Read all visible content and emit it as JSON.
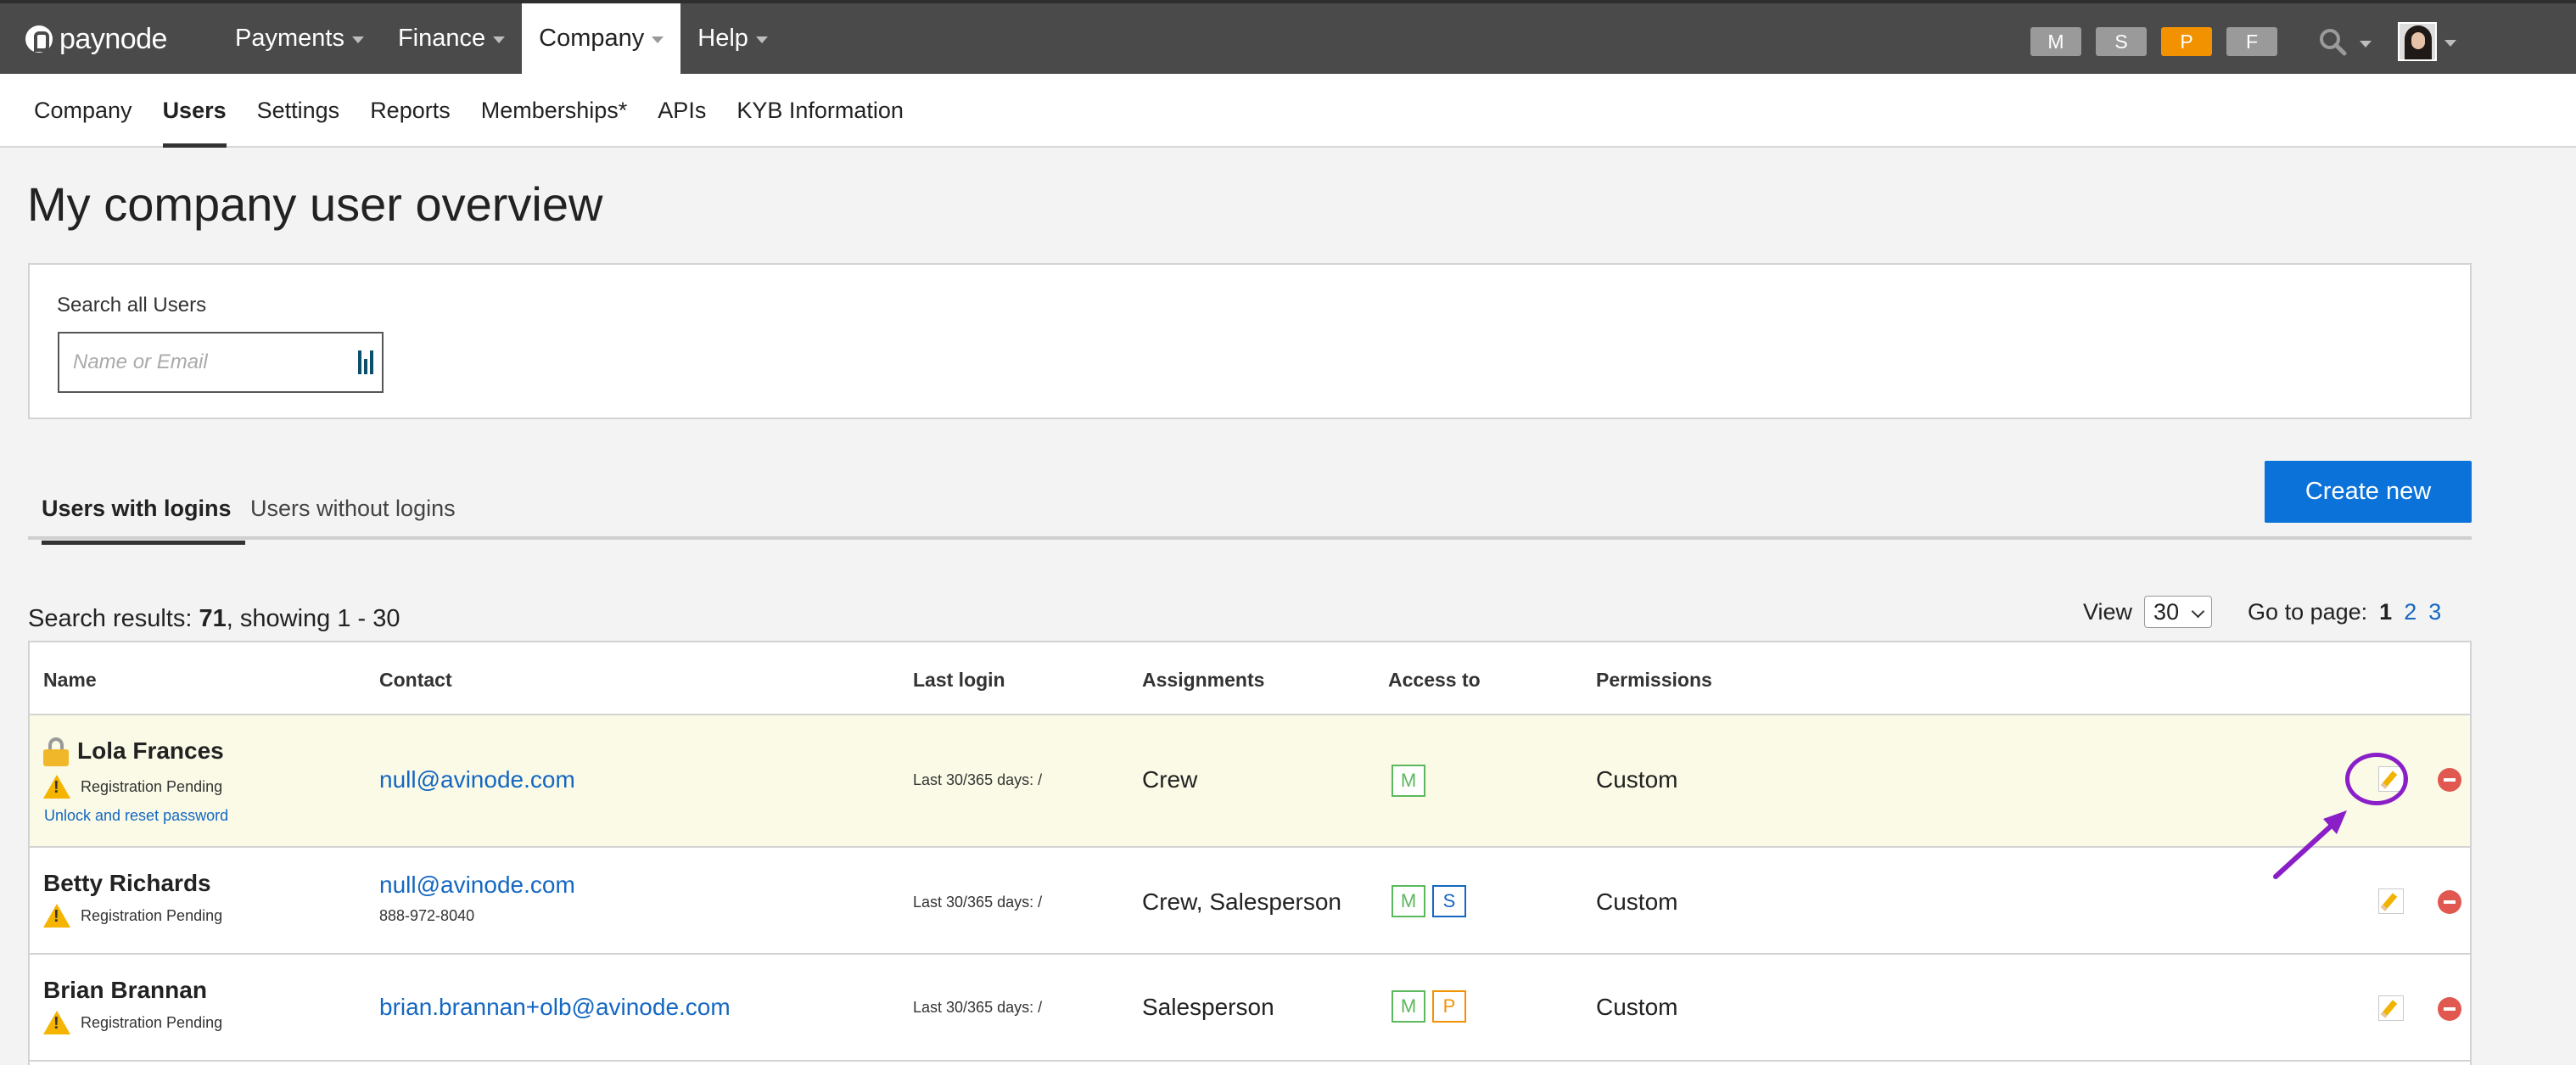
{
  "brand": {
    "name": "paynode"
  },
  "topnav": [
    {
      "label": "Payments",
      "active": false
    },
    {
      "label": "Finance",
      "active": false
    },
    {
      "label": "Company",
      "active": true
    },
    {
      "label": "Help",
      "active": false
    }
  ],
  "product_pills": [
    {
      "label": "M",
      "color": "#9a9a9a"
    },
    {
      "label": "S",
      "color": "#9a9a9a"
    },
    {
      "label": "P",
      "color": "#f39200"
    },
    {
      "label": "F",
      "color": "#9a9a9a"
    }
  ],
  "subnav": [
    {
      "label": "Company",
      "active": false
    },
    {
      "label": "Users",
      "active": true
    },
    {
      "label": "Settings",
      "active": false
    },
    {
      "label": "Reports",
      "active": false
    },
    {
      "label": "Memberships*",
      "active": false
    },
    {
      "label": "APIs",
      "active": false
    },
    {
      "label": "KYB Information",
      "active": false
    }
  ],
  "page_title": "My company user overview",
  "search": {
    "label": "Search all Users",
    "placeholder": "Name or Email",
    "value": ""
  },
  "tabs": [
    {
      "label": "Users with logins",
      "active": true
    },
    {
      "label": "Users without logins",
      "active": false
    }
  ],
  "create_button": "Create new",
  "results": {
    "prefix": "Search results: ",
    "total": "71",
    "showing": ", showing 1 - 30"
  },
  "pagination": {
    "view_label": "View",
    "per_page": "30",
    "goto_label": "Go to page:",
    "pages": [
      "1",
      "2",
      "3"
    ],
    "current": "1"
  },
  "table": {
    "columns": [
      "Name",
      "Contact",
      "Last login",
      "Assignments",
      "Access to",
      "Permissions"
    ],
    "rows": [
      {
        "name": "Lola Frances",
        "locked": true,
        "status": "Registration Pending",
        "action_link": "Unlock and reset password",
        "email": "null@avinode.com",
        "phone": "",
        "last_login": "Last 30/365 days: /",
        "assignments": "Crew",
        "access": [
          "M"
        ],
        "permissions": "Custom",
        "highlighted": true
      },
      {
        "name": "Betty Richards",
        "locked": false,
        "status": "Registration Pending",
        "action_link": "",
        "email": "null@avinode.com",
        "phone": "888-972-8040",
        "last_login": "Last 30/365 days: /",
        "assignments": "Crew, Salesperson",
        "access": [
          "M",
          "S"
        ],
        "permissions": "Custom",
        "highlighted": false
      },
      {
        "name": "Brian Brannan",
        "locked": false,
        "status": "Registration Pending",
        "action_link": "",
        "email": "brian.brannan+olb@avinode.com",
        "phone": "",
        "last_login": "Last 30/365 days: /",
        "assignments": "Salesperson",
        "access": [
          "M",
          "P"
        ],
        "permissions": "Custom",
        "highlighted": false
      }
    ]
  },
  "annotation_color": "#8a1fc8"
}
